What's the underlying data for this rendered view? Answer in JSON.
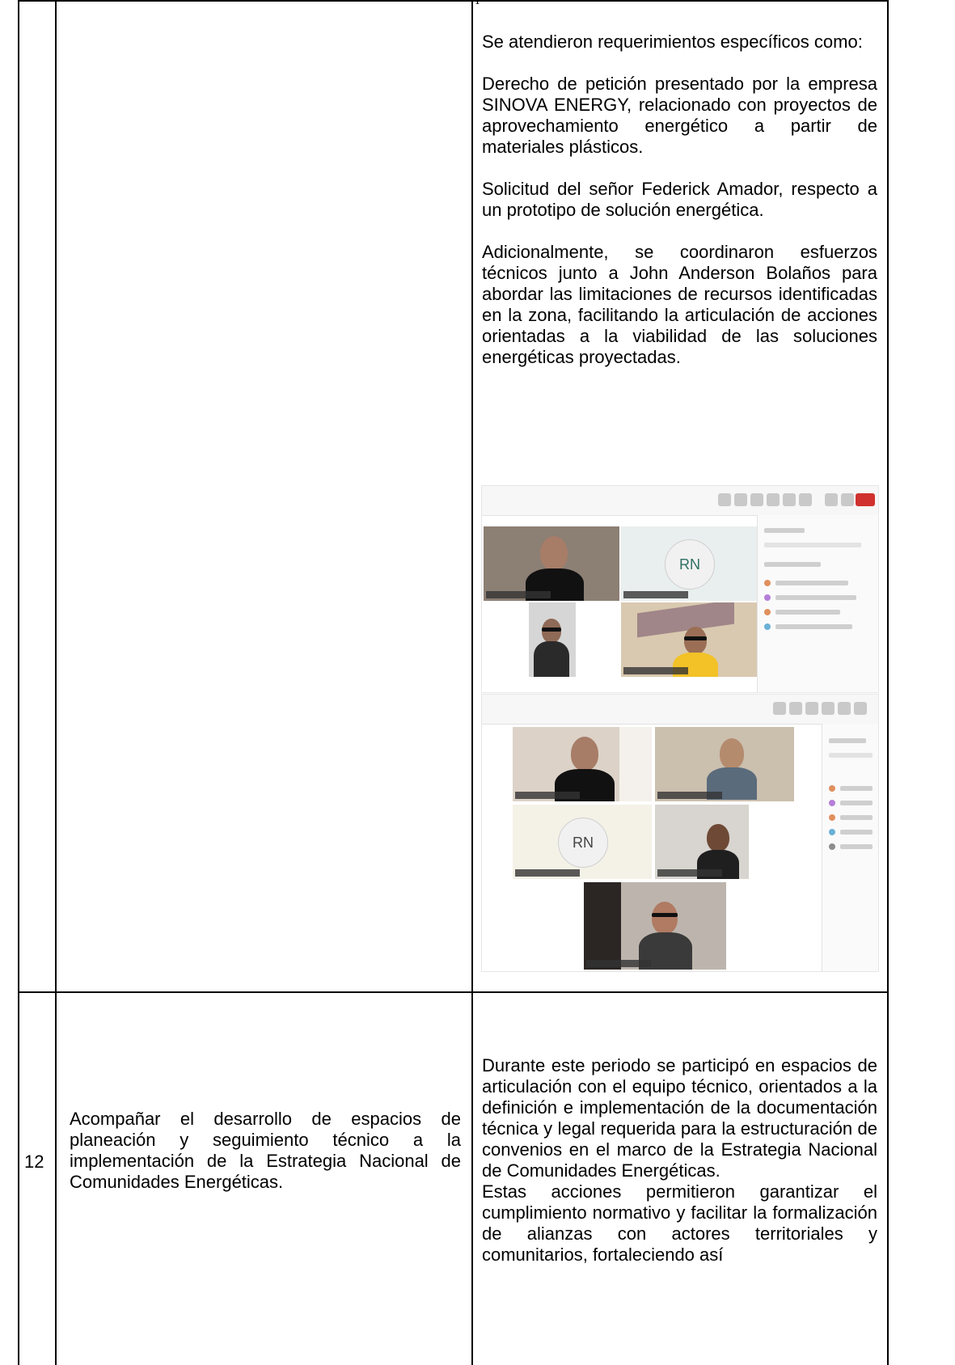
{
  "header_fragment": "l ",
  "row1": {
    "number": "",
    "activity": "",
    "paragraphs": [
      "Se atendieron requerimientos específicos como:",
      "Derecho de petición presentado por la empresa SINOVA ENERGY, relacionado con proyectos de aprovechamiento energético a partir de materiales plásticos.",
      "Solicitud del señor Federick Amador, respecto a un prototipo de solución energética.",
      "Adicionalmente, se coordinaron esfuerzos técnicos junto a John Anderson Bolaños para abordar las limitaciones de recursos identificadas en la zona, facilitando la articulación de acciones orientadas a la viabilidad de las soluciones energéticas proyectadas."
    ],
    "screenshot1": {
      "avatar_initials": "RN"
    },
    "screenshot2": {
      "avatar_initials": "RN"
    }
  },
  "row2": {
    "number": "12",
    "activity": "Acompañar el desarrollo de espacios de planeación y seguimiento técnico a la implementación de la Estrategia Nacional de Comunidades Energéticas.",
    "results_p1": "Durante este periodo se participó en espacios de articulación con el equipo técnico, orientados a la definición e implementación de la documentación técnica y legal requerida para la estructuración de convenios en el marco de la Estrategia Nacional de Comunidades Energéticas.",
    "results_p2": "Estas acciones permitieron garantizar el cumplimiento normativo y facilitar la formalización de alianzas con actores territoriales y comunitarios, fortaleciendo así"
  },
  "colors": {
    "border": "#000000",
    "text": "#000000"
  }
}
